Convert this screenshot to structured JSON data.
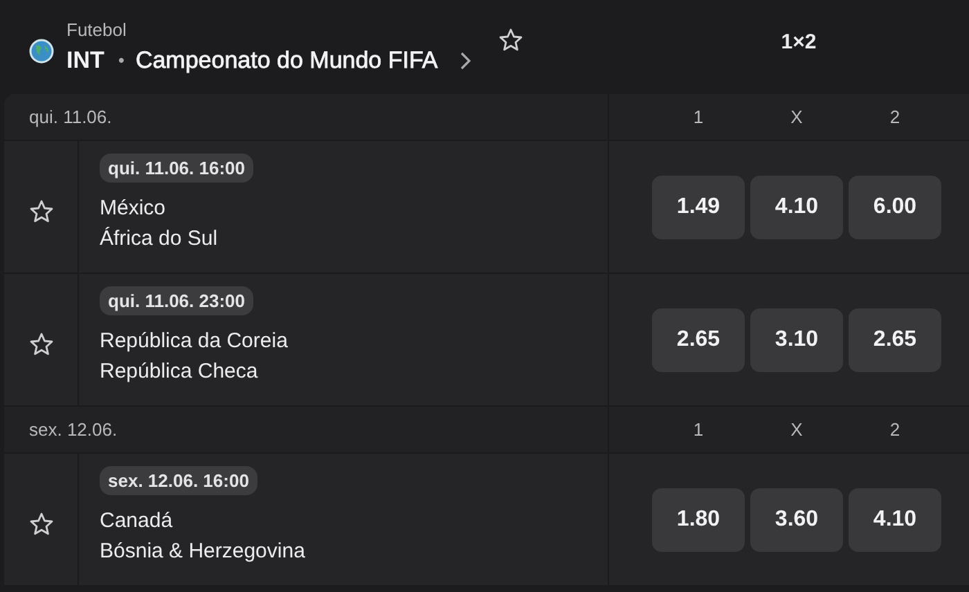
{
  "header": {
    "sport": "Futebol",
    "region": "INT",
    "separator": "•",
    "competition": "Campeonato do Mundo FIFA",
    "favorite": false,
    "market": "1×2"
  },
  "groups": [
    {
      "date": "qui. 11.06.",
      "columns": [
        "1",
        "X",
        "2"
      ],
      "matches": [
        {
          "time": "qui. 11.06. 16:00",
          "home": "México",
          "away": "África do Sul",
          "favorite": false,
          "odds": [
            "1.49",
            "4.10",
            "6.00"
          ]
        },
        {
          "time": "qui. 11.06. 23:00",
          "home": "República da Coreia",
          "away": "República Checa",
          "favorite": false,
          "odds": [
            "2.65",
            "3.10",
            "2.65"
          ]
        }
      ]
    },
    {
      "date": "sex. 12.06.",
      "columns": [
        "1",
        "X",
        "2"
      ],
      "matches": [
        {
          "time": "sex. 12.06. 16:00",
          "home": "Canadá",
          "away": "Bósnia & Herzegovina",
          "favorite": false,
          "odds": [
            "1.80",
            "3.60",
            "4.10"
          ]
        }
      ]
    }
  ]
}
